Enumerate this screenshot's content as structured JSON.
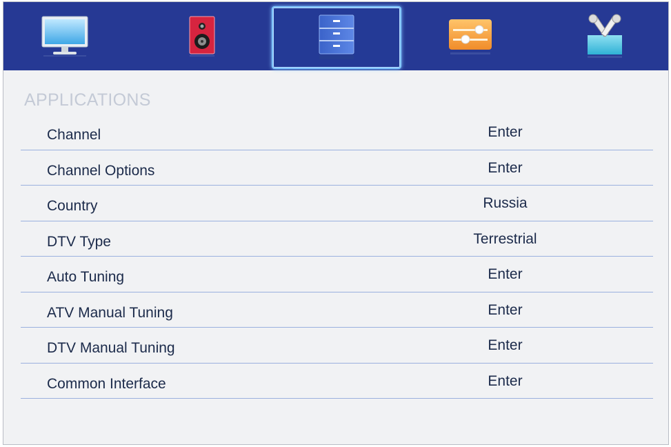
{
  "top_menu": {
    "tabs": [
      {
        "icon": "monitor-icon",
        "label": "Picture"
      },
      {
        "icon": "speaker-icon",
        "label": "Sound"
      },
      {
        "icon": "cabinet-icon",
        "label": "Applications",
        "selected": true
      },
      {
        "icon": "sliders-icon",
        "label": "Options"
      },
      {
        "icon": "tools-icon",
        "label": "Setup"
      }
    ],
    "accent_color": "#263994",
    "highlight_color": "#7fc4ff"
  },
  "section": {
    "title": "APPLICATIONS"
  },
  "menu_items": [
    {
      "label": "Channel",
      "value": "Enter"
    },
    {
      "label": "Channel Options",
      "value": "Enter"
    },
    {
      "label": "Country",
      "value": "Russia"
    },
    {
      "label": "DTV Type",
      "value": "Terrestrial"
    },
    {
      "label": "Auto Tuning",
      "value": "Enter"
    },
    {
      "label": "ATV Manual Tuning",
      "value": "Enter"
    },
    {
      "label": "DTV Manual Tuning",
      "value": "Enter"
    },
    {
      "label": "Common Interface",
      "value": "Enter"
    }
  ]
}
